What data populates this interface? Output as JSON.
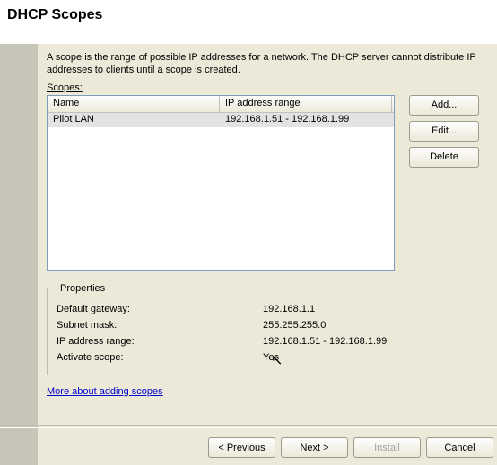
{
  "pageTitle": "DHCP Scopes",
  "intro": "A scope is the range of possible IP addresses for a network. The DHCP server cannot distribute IP addresses to clients until a scope is created.",
  "scopesLabel": "Scopes:",
  "columns": {
    "name": "Name",
    "range": "IP address range"
  },
  "rows": [
    {
      "name": "Pilot LAN",
      "range": "192.168.1.51 - 192.168.1.99"
    }
  ],
  "buttons": {
    "add": "Add...",
    "edit": "Edit...",
    "delete_": "Delete",
    "previous": "< Previous",
    "next": "Next >",
    "install": "Install",
    "cancel": "Cancel"
  },
  "propsLegend": "Properties",
  "props": {
    "gatewayLabel": "Default gateway:",
    "gatewayValue": "192.168.1.1",
    "maskLabel": "Subnet mask:",
    "maskValue": "255.255.255.0",
    "rangeLabel": "IP address range:",
    "rangeValue": "192.168.1.51 - 192.168.1.99",
    "activateLabel": "Activate scope:",
    "activateValue": "Yes"
  },
  "link": "More about adding scopes"
}
